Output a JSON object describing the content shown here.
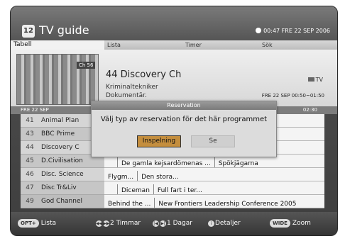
{
  "header": {
    "title": "TV guide",
    "clock": "00:47 FRE 22 SEP 2006"
  },
  "tabs": [
    "Tabell",
    "Lista",
    "Timer",
    "Sök"
  ],
  "info": {
    "thumb_badge": "Ch 56",
    "channel": "44 Discovery Ch",
    "program_title": "Kriminaltekniker",
    "program_genre": "Dokumentär.",
    "tv_badge": "TV",
    "time_range": "FRE 22 SEP 00:50~01:50"
  },
  "datebar": {
    "date": "FRE 22 SEP",
    "time": "02:30"
  },
  "channels": [
    {
      "num": "41",
      "name": "Animal Plan",
      "programs": []
    },
    {
      "num": "43",
      "name": "BBC Prime",
      "programs": []
    },
    {
      "num": "44",
      "name": "Discovery C",
      "programs": []
    },
    {
      "num": "45",
      "name": "D.Civilisation",
      "programs": [
        "De gamla kejsardömenas ...",
        "Spökjägarna"
      ]
    },
    {
      "num": "46",
      "name": "Disc. Science",
      "programs": [
        "Flygm...",
        "Den stora..."
      ]
    },
    {
      "num": "47",
      "name": "Disc Tr&Liv",
      "programs": [
        "Diceman",
        "Full fart i ter..."
      ]
    },
    {
      "num": "49",
      "name": "God Channel",
      "programs": [
        "Behind the ...",
        "New Frontiers Leadership Conference 2005"
      ]
    }
  ],
  "dialog": {
    "title": "Reservation",
    "message": "Välj typ av reservation för det här programmet",
    "record_label": "Inspelning",
    "watch_label": "Se"
  },
  "footer": {
    "opt_badge": "OPT+",
    "list_label": "Lista",
    "hours_label": "2 Timmar",
    "days_label": "1 Dagar",
    "info_badge": "i",
    "details_label": "Detaljer",
    "wide_badge": "WIDE",
    "zoom_label": "Zoom"
  }
}
